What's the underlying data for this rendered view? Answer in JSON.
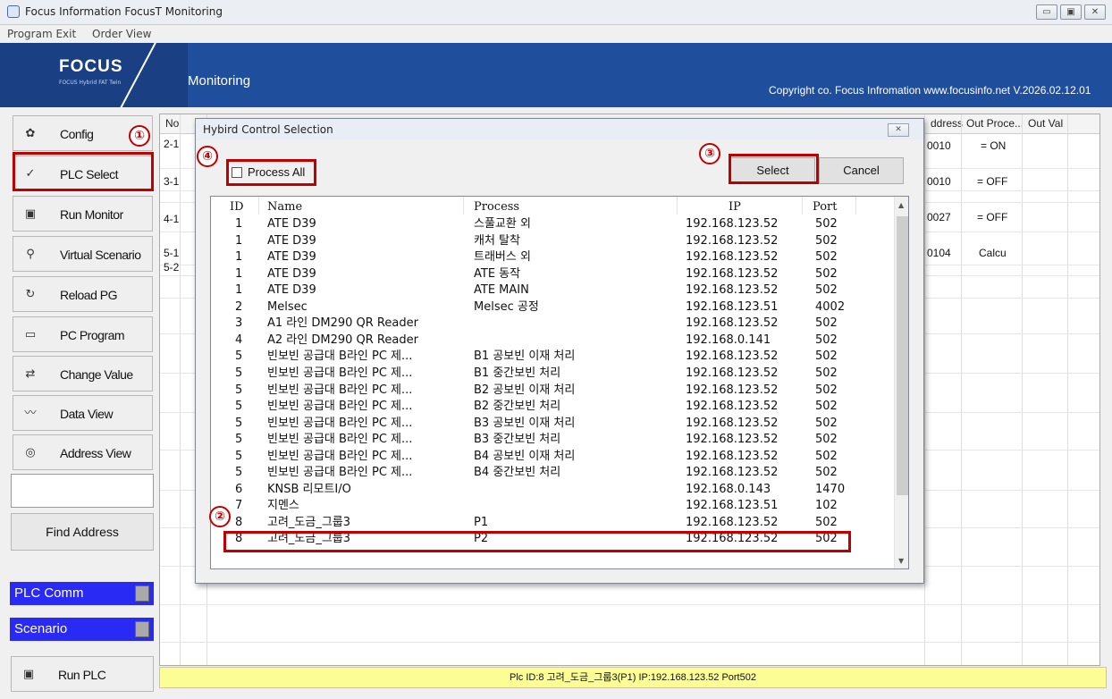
{
  "window": {
    "title": "Focus Information FocusT Monitoring",
    "controls": [
      "▭",
      "▣",
      "✕"
    ]
  },
  "menu": [
    "Program Exit",
    "Order View"
  ],
  "banner": {
    "logo": "FOCUS",
    "logo_sub": "FOCUS Hybrid FAT Twin",
    "section": "Monitoring",
    "copyright": "Copyright co. Focus Infromation www.focusinfo.net V.2026.02.12.01"
  },
  "sidebar": {
    "items": [
      {
        "label": "Config",
        "icon": "gear-icon",
        "glyph": "✿"
      },
      {
        "label": "PLC Select",
        "icon": "check-icon",
        "glyph": "✓"
      },
      {
        "label": "Run Monitor",
        "icon": "monitor-icon",
        "glyph": "▣"
      },
      {
        "label": "Virtual Scenario",
        "icon": "pin-icon",
        "glyph": "⚲"
      },
      {
        "label": "Reload PG",
        "icon": "reload-icon",
        "glyph": "↻"
      },
      {
        "label": "PC Program",
        "icon": "window-icon",
        "glyph": "▭"
      },
      {
        "label": "Change Value",
        "icon": "swap-icon",
        "glyph": "⇄"
      },
      {
        "label": "Data View",
        "icon": "chart-icon",
        "glyph": "〰"
      },
      {
        "label": "Address View",
        "icon": "address-icon",
        "glyph": "◎"
      }
    ],
    "search_value": "",
    "find_label": "Find Address",
    "plc_comm": "PLC Comm",
    "scenario": "Scenario",
    "run_plc": "Run PLC",
    "run_plc_glyph": "▣"
  },
  "grid": {
    "headers": {
      "no": "No",
      "address": "ddress",
      "out_process": "Out Proce...",
      "out_val": "Out Val"
    },
    "rows": [
      {
        "no": "2-1",
        "address": "0010",
        "out_process": "= ON"
      },
      {
        "no": "3-1",
        "address": "0010",
        "out_process": "= OFF"
      },
      {
        "no": "4-1",
        "address": "0027",
        "out_process": "= OFF"
      },
      {
        "no": "5-1",
        "address": "0104",
        "out_process": "Calcu"
      },
      {
        "no": "5-2",
        "address": "",
        "out_process": ""
      }
    ]
  },
  "statusbar": "Plc ID:8 고려_도금_그룹3(P1) IP:192.168.123.52 Port502",
  "dialog": {
    "title": "Hybird Control Selection",
    "process_all": "Process All",
    "select": "Select",
    "cancel": "Cancel",
    "columns": {
      "id": "ID",
      "name": "Name",
      "process": "Process",
      "ip": "IP",
      "port": "Port"
    },
    "rows": [
      {
        "id": "1",
        "name": "ATE D39",
        "process": "스풀교환 외",
        "ip": "192.168.123.52",
        "port": "502"
      },
      {
        "id": "1",
        "name": "ATE D39",
        "process": "캐처 탈착",
        "ip": "192.168.123.52",
        "port": "502"
      },
      {
        "id": "1",
        "name": "ATE D39",
        "process": "트래버스 외",
        "ip": "192.168.123.52",
        "port": "502"
      },
      {
        "id": "1",
        "name": "ATE D39",
        "process": "ATE 동작",
        "ip": "192.168.123.52",
        "port": "502"
      },
      {
        "id": "1",
        "name": "ATE D39",
        "process": "ATE MAIN",
        "ip": "192.168.123.52",
        "port": "502"
      },
      {
        "id": "2",
        "name": "Melsec",
        "process": "Melsec 공정",
        "ip": "192.168.123.51",
        "port": "4002"
      },
      {
        "id": "3",
        "name": "A1 라인 DM290 QR Reader",
        "process": "",
        "ip": "192.168.123.52",
        "port": "502"
      },
      {
        "id": "4",
        "name": "A2 라인 DM290 QR Reader",
        "process": "",
        "ip": "192.168.0.141",
        "port": "502"
      },
      {
        "id": "5",
        "name": "빈보빈 공급대 B라인 PC 제...",
        "process": "B1 공보빈 이재 처리",
        "ip": "192.168.123.52",
        "port": "502"
      },
      {
        "id": "5",
        "name": "빈보빈 공급대 B라인 PC 제...",
        "process": "B1 중간보빈 처리",
        "ip": "192.168.123.52",
        "port": "502"
      },
      {
        "id": "5",
        "name": "빈보빈 공급대 B라인 PC 제...",
        "process": "B2 공보빈 이재 처리",
        "ip": "192.168.123.52",
        "port": "502"
      },
      {
        "id": "5",
        "name": "빈보빈 공급대 B라인 PC 제...",
        "process": "B2 중간보빈 처리",
        "ip": "192.168.123.52",
        "port": "502"
      },
      {
        "id": "5",
        "name": "빈보빈 공급대 B라인 PC 제...",
        "process": "B3 공보빈 이재 처리",
        "ip": "192.168.123.52",
        "port": "502"
      },
      {
        "id": "5",
        "name": "빈보빈 공급대 B라인 PC 제...",
        "process": "B3 중간보빈 처리",
        "ip": "192.168.123.52",
        "port": "502"
      },
      {
        "id": "5",
        "name": "빈보빈 공급대 B라인 PC 제...",
        "process": "B4 공보빈 이재 처리",
        "ip": "192.168.123.52",
        "port": "502"
      },
      {
        "id": "5",
        "name": "빈보빈 공급대 B라인 PC 제...",
        "process": "B4 중간보빈 처리",
        "ip": "192.168.123.52",
        "port": "502"
      },
      {
        "id": "6",
        "name": "KNSB 리모트I/O",
        "process": "",
        "ip": "192.168.0.143",
        "port": "1470"
      },
      {
        "id": "7",
        "name": "지멘스",
        "process": "",
        "ip": "192.168.123.51",
        "port": "102"
      },
      {
        "id": "8",
        "name": "고려_도금_그룹3",
        "process": "P1",
        "ip": "192.168.123.52",
        "port": "502"
      },
      {
        "id": "8",
        "name": "고려_도금_그룹3",
        "process": "P2",
        "ip": "192.168.123.52",
        "port": "502"
      }
    ]
  },
  "annotations": [
    "①",
    "②",
    "③",
    "④"
  ],
  "colors": {
    "banner": "#1f4e9d",
    "highlight": "#c00000",
    "status_blue": "#2a2af5",
    "statusbar": "#fdfd96"
  }
}
